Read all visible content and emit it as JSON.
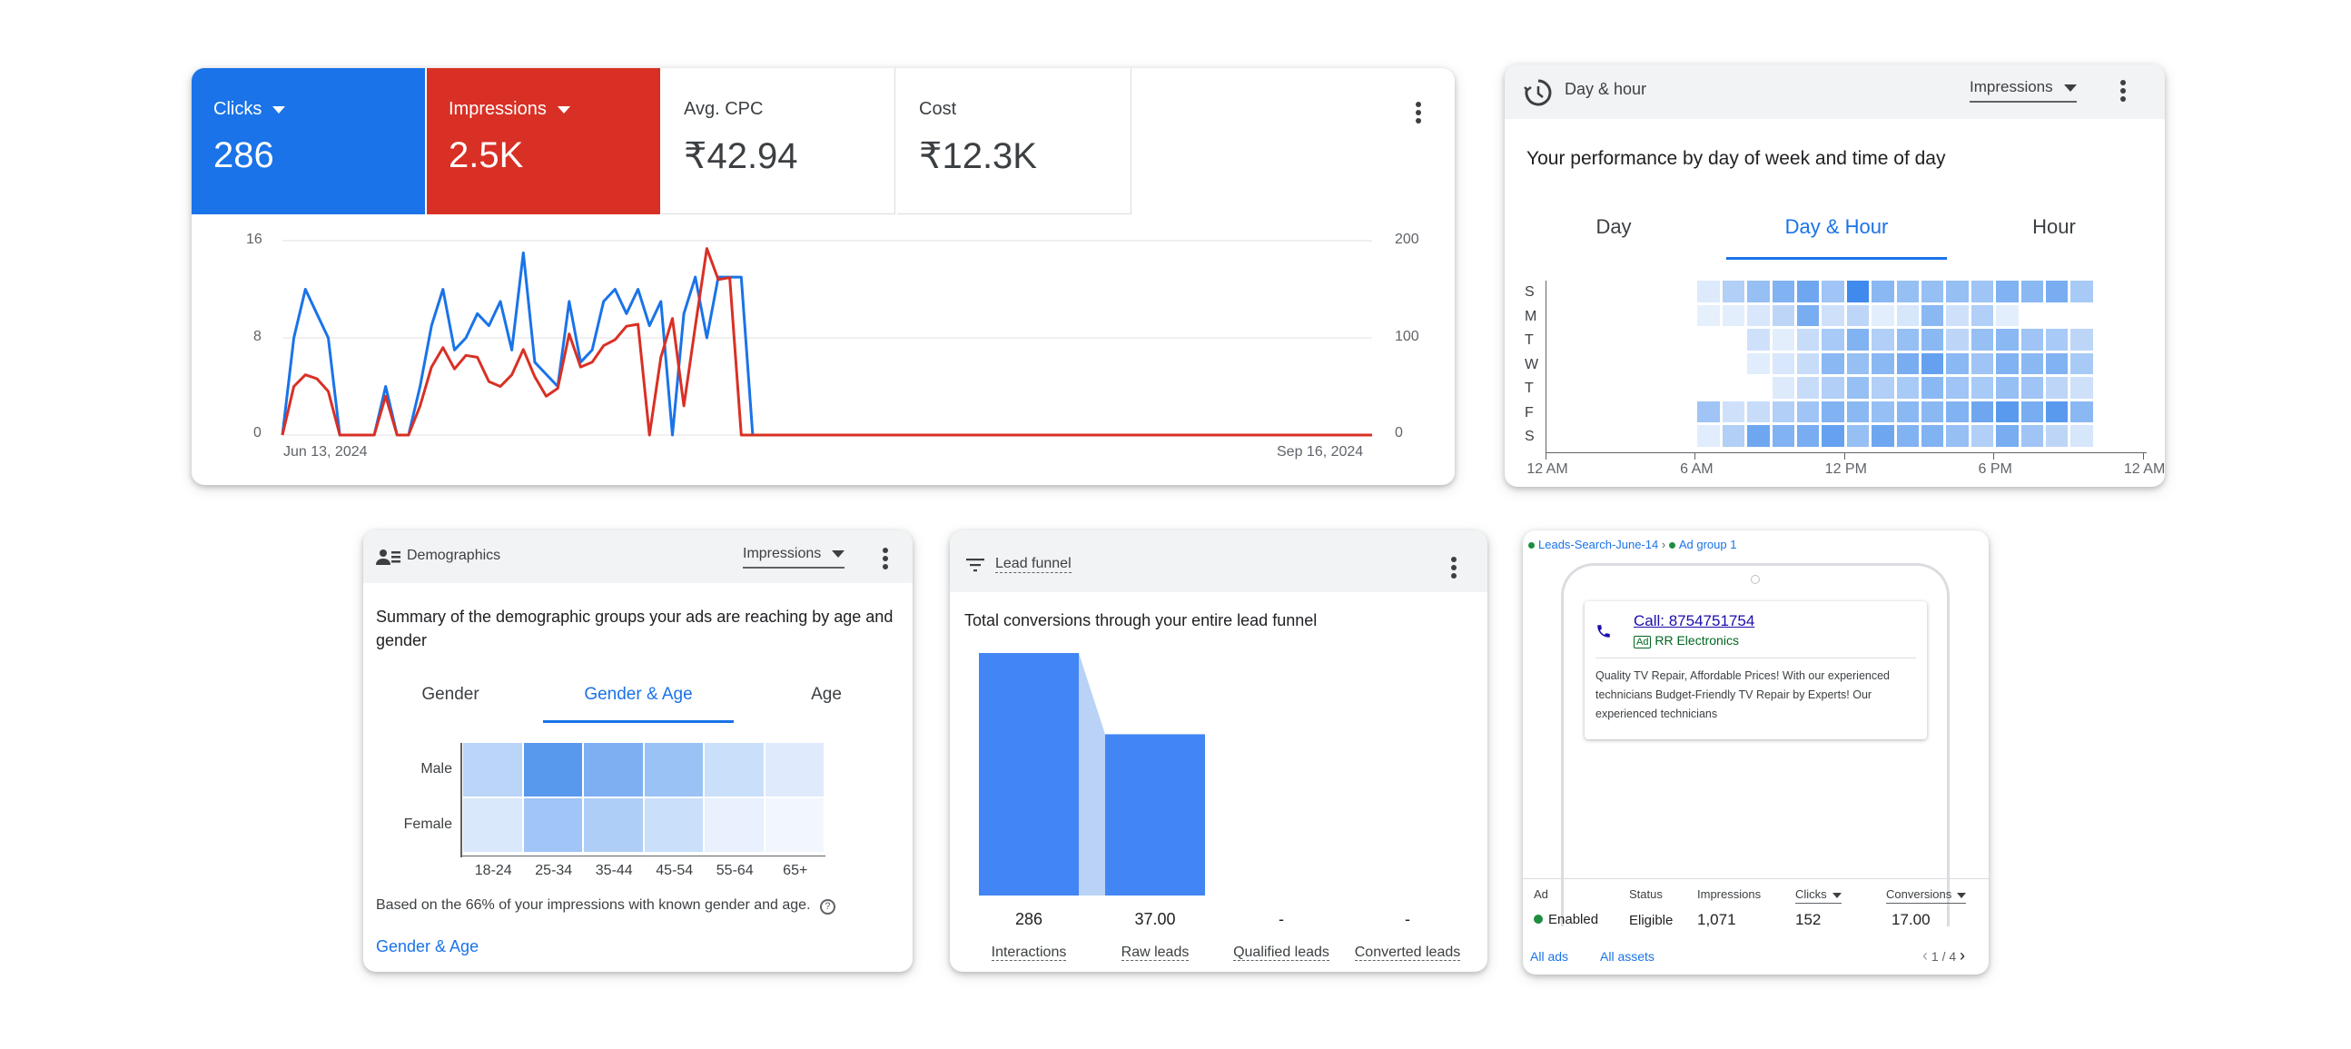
{
  "performance": {
    "metrics": [
      {
        "label": "Clicks",
        "value": "286",
        "active": true,
        "bg": "#1a73e8"
      },
      {
        "label": "Impressions",
        "value": "2.5K",
        "active": true,
        "bg": "#d93025"
      },
      {
        "label": "Avg. CPC",
        "value": "₹42.94",
        "active": false
      },
      {
        "label": "Cost",
        "value": "₹12.3K",
        "active": false
      }
    ],
    "left_axis": [
      "16",
      "8",
      "0"
    ],
    "right_axis": [
      "200",
      "100",
      "0"
    ],
    "start_date": "Jun 13, 2024",
    "end_date": "Sep 16, 2024"
  },
  "chart_data": {
    "type": "line",
    "x_range": [
      "Jun 13, 2024",
      "Sep 16, 2024"
    ],
    "y_left": [
      0,
      16
    ],
    "y_right": [
      0,
      200
    ],
    "series": [
      {
        "name": "Clicks",
        "color": "#1a73e8",
        "axis": "left",
        "values": [
          0,
          8,
          12,
          10,
          8,
          0,
          0,
          0,
          0,
          4,
          0,
          0,
          4,
          9,
          12,
          7,
          8,
          10,
          9,
          11,
          7,
          15,
          6,
          5,
          4,
          11,
          6,
          7,
          11,
          12,
          10,
          12,
          9,
          11,
          0,
          10,
          13,
          8,
          13,
          13,
          13,
          0,
          0,
          0,
          0,
          0,
          0,
          0,
          0,
          0,
          0,
          0,
          0,
          0,
          0,
          0,
          0,
          0,
          0,
          0,
          0,
          0,
          0,
          0,
          0,
          0,
          0,
          0,
          0,
          0,
          0,
          0,
          0,
          0,
          0,
          0,
          0,
          0,
          0,
          0,
          0,
          0,
          0,
          0,
          0,
          0,
          0,
          0,
          0,
          0,
          0,
          0,
          0,
          0,
          0,
          0
        ]
      },
      {
        "name": "Impressions",
        "color": "#d93025",
        "axis": "right",
        "values": [
          0,
          50,
          62,
          58,
          45,
          0,
          0,
          0,
          0,
          40,
          0,
          0,
          30,
          70,
          90,
          68,
          82,
          80,
          55,
          50,
          62,
          88,
          60,
          40,
          48,
          104,
          70,
          75,
          92,
          98,
          112,
          114,
          0,
          80,
          120,
          30,
          112,
          192,
          160,
          162,
          0,
          0,
          0,
          0,
          0,
          0,
          0,
          0,
          0,
          0,
          0,
          0,
          0,
          0,
          0,
          0,
          0,
          0,
          0,
          0,
          0,
          0,
          0,
          0,
          0,
          0,
          0,
          0,
          0,
          0,
          0,
          0,
          0,
          0,
          0,
          0,
          0,
          0,
          0,
          0,
          0,
          0,
          0,
          0,
          0,
          0,
          0,
          0,
          0,
          0,
          0,
          0,
          0,
          0,
          0,
          0
        ]
      }
    ]
  },
  "day_hour": {
    "title": "Day & hour",
    "dropdown": "Impressions",
    "subtitle": "Your performance by day of week and time of day",
    "tabs": [
      "Day",
      "Day & Hour",
      "Hour"
    ],
    "selected_tab": 1,
    "day_labels": [
      "S",
      "M",
      "T",
      "W",
      "T",
      "F",
      "S"
    ],
    "hour_labels": [
      "12 AM",
      "6 AM",
      "12 PM",
      "6 PM",
      "12 AM"
    ],
    "cell_base_color": "#1a73e8",
    "intensity": [
      [
        0,
        0,
        0,
        0,
        0,
        0,
        0.08,
        0.3,
        0.45,
        0.55,
        0.65,
        0.4,
        0.9,
        0.5,
        0.45,
        0.45,
        0.45,
        0.4,
        0.55,
        0.5,
        0.6,
        0.35,
        0,
        0
      ],
      [
        0,
        0,
        0,
        0,
        0,
        0,
        0.03,
        0.05,
        0.1,
        0.25,
        0.6,
        0.15,
        0.25,
        0.05,
        0.12,
        0.5,
        0.15,
        0.3,
        0.05,
        0,
        0,
        0,
        0,
        0
      ],
      [
        0,
        0,
        0,
        0,
        0,
        0,
        0,
        0,
        0.15,
        0.05,
        0.2,
        0.35,
        0.55,
        0.3,
        0.45,
        0.5,
        0.25,
        0.45,
        0.5,
        0.4,
        0.35,
        0.25,
        0,
        0
      ],
      [
        0,
        0,
        0,
        0,
        0,
        0,
        0,
        0,
        0.06,
        0.1,
        0.2,
        0.5,
        0.45,
        0.5,
        0.6,
        0.7,
        0.5,
        0.4,
        0.55,
        0.5,
        0.55,
        0.35,
        0,
        0
      ],
      [
        0,
        0,
        0,
        0,
        0,
        0,
        0,
        0,
        0,
        0.08,
        0.2,
        0.3,
        0.45,
        0.3,
        0.35,
        0.5,
        0.4,
        0.35,
        0.45,
        0.4,
        0.25,
        0.15,
        0,
        0
      ],
      [
        0,
        0,
        0,
        0,
        0,
        0,
        0.4,
        0.15,
        0.2,
        0.3,
        0.4,
        0.55,
        0.5,
        0.45,
        0.5,
        0.5,
        0.55,
        0.65,
        0.75,
        0.6,
        0.75,
        0.5,
        0,
        0
      ],
      [
        0,
        0,
        0,
        0,
        0,
        0,
        0.06,
        0.3,
        0.65,
        0.55,
        0.6,
        0.7,
        0.45,
        0.65,
        0.55,
        0.55,
        0.45,
        0.3,
        0.6,
        0.4,
        0.25,
        0.12,
        0,
        0
      ]
    ]
  },
  "demographics": {
    "title": "Demographics",
    "dropdown": "Impressions",
    "subtitle": "Summary of the demographic groups your ads are reaching by age and gender",
    "tabs": [
      "Gender",
      "Gender & Age",
      "Age"
    ],
    "selected_tab": 1,
    "rows": [
      "Male",
      "Female"
    ],
    "cols": [
      "18-24",
      "25-34",
      "35-44",
      "45-54",
      "55-64",
      "65+"
    ],
    "intensity": [
      [
        0.3,
        0.78,
        0.6,
        0.45,
        0.22,
        0.12
      ],
      [
        0.14,
        0.42,
        0.36,
        0.22,
        0.08,
        0.03
      ]
    ],
    "footnote": "Based on the 66% of your impressions with known gender and age.",
    "link": "Gender & Age"
  },
  "lead_funnel": {
    "title": "Lead funnel",
    "subtitle": "Total conversions through your entire lead funnel",
    "stages": [
      {
        "label": "Interactions",
        "value": "286",
        "amount": 286
      },
      {
        "label": "Raw leads",
        "value": "37.00",
        "amount": 37
      },
      {
        "label": "Qualified leads",
        "value": "-",
        "amount": 0
      },
      {
        "label": "Converted leads",
        "value": "-",
        "amount": 0
      }
    ]
  },
  "ad_preview": {
    "breadcrumb_campaign": "Leads-Search-June-14",
    "breadcrumb_sep": "›",
    "breadcrumb_group": "Ad group 1",
    "call_text": "Call: 8754751754",
    "ad_badge": "Ad",
    "advertiser": "RR Electronics",
    "description": "Quality TV Repair, Affordable Prices! With our experienced technicians Budget-Friendly TV Repair by Experts! Our experienced technicians",
    "table_headers": [
      "Ad",
      "Status",
      "Impressions",
      "Clicks",
      "Conversions"
    ],
    "table_values": [
      "Enabled",
      "Eligible",
      "1,071",
      "152",
      "17.00"
    ],
    "links": [
      "All ads",
      "All assets"
    ],
    "pager": "1 / 4"
  }
}
